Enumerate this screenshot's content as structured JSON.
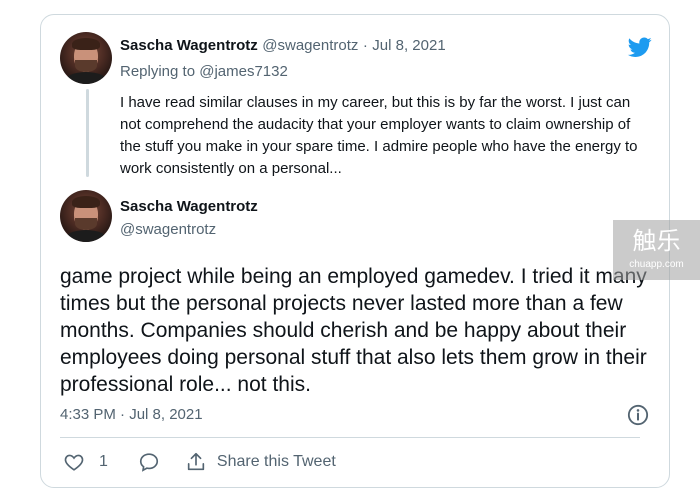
{
  "quoted_tweet": {
    "author_name": "Sascha Wagentrotz",
    "author_handle": "@swagentrotz",
    "separator": "·",
    "date": "Jul 8, 2021",
    "replying_label": "Replying to",
    "replying_handle": "@james7132",
    "text": "I have read similar clauses in my career, but this is by far the worst. I just can not comprehend the audacity that your employer wants to claim ownership of the stuff you make in your spare time. I admire people who have the energy to work consistently on a personal..."
  },
  "main_tweet": {
    "author_name": "Sascha Wagentrotz",
    "author_handle": "@swagentrotz",
    "text": "game project while being an employed gamedev. I tried it many times but the personal projects never lasted more than a few months. Companies should cherish and be happy about their employees doing personal stuff that also lets them grow in their professional role... not this.",
    "timestamp": "4:33 PM · Jul 8, 2021"
  },
  "actions": {
    "like_count": "1",
    "share_label": "Share this Tweet"
  },
  "watermark": {
    "main": "触乐",
    "sub": "chuapp.com"
  },
  "colors": {
    "twitter_blue": "#1d9bf0",
    "muted": "#536471",
    "text": "#0f1419",
    "border": "#cfd9de"
  },
  "icons": [
    "twitter-bird-icon",
    "info-icon",
    "heart-icon",
    "reply-icon",
    "share-icon"
  ]
}
